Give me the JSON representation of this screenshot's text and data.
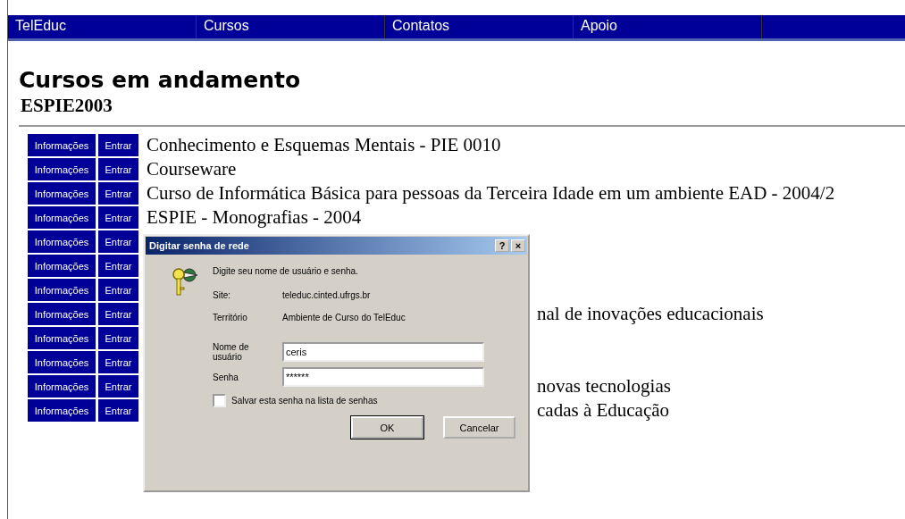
{
  "menu": [
    {
      "label": "TelEduc"
    },
    {
      "label": "Cursos"
    },
    {
      "label": "Contatos"
    },
    {
      "label": "Apoio"
    }
  ],
  "heading": "Cursos em andamento",
  "subheading": "ESPIE2003",
  "courses": [
    {
      "info": "Informações",
      "enter": "Entrar",
      "name": "Conhecimento e Esquemas Mentais - PIE 0010",
      "kind": "full"
    },
    {
      "info": "Informações",
      "enter": "Entrar",
      "name": "Courseware",
      "kind": "full"
    },
    {
      "info": "Informações",
      "enter": "Entrar",
      "name": "Curso de Informática Básica para pessoas da Terceira Idade em um ambiente EAD - 2004/2",
      "kind": "full"
    },
    {
      "info": "Informações",
      "enter": "Entrar",
      "name": "ESPIE - Monografias - 2004",
      "kind": "full"
    },
    {
      "info": "Informações",
      "enter": "Entrar"
    },
    {
      "info": "Informações",
      "enter": "Entrar"
    },
    {
      "info": "Informações",
      "enter": "Entrar"
    },
    {
      "info": "Informações",
      "enter": "Entrar",
      "name": "nal de inovações educacionais",
      "kind": "tail"
    },
    {
      "info": "Informações",
      "enter": "Entrar"
    },
    {
      "info": "Informações",
      "enter": "Entrar"
    },
    {
      "info": "Informações",
      "enter": "Entrar",
      "name": "novas tecnologias",
      "kind": "tail"
    },
    {
      "info": "Informações",
      "enter": "Entrar",
      "name": "cadas à Educação",
      "kind": "tail"
    }
  ],
  "dialog": {
    "title": "Digitar senha de rede",
    "help": "?",
    "close": "×",
    "prompt": "Digite seu nome de usuário e senha.",
    "info": [
      {
        "label": "Site:",
        "value": "teleduc.cinted.ufrgs.br"
      },
      {
        "label": "Território",
        "value": "Ambiente de Curso do TelEduc"
      }
    ],
    "fields": [
      {
        "label": "Nome de usuário",
        "value": "ceris"
      },
      {
        "label": "Senha",
        "value": "******"
      }
    ],
    "save_password": {
      "label": "Salvar esta senha na lista de senhas",
      "checked": false
    },
    "buttons": [
      {
        "label": "OK",
        "default": true
      },
      {
        "label": "Cancelar",
        "default": false
      }
    ]
  }
}
